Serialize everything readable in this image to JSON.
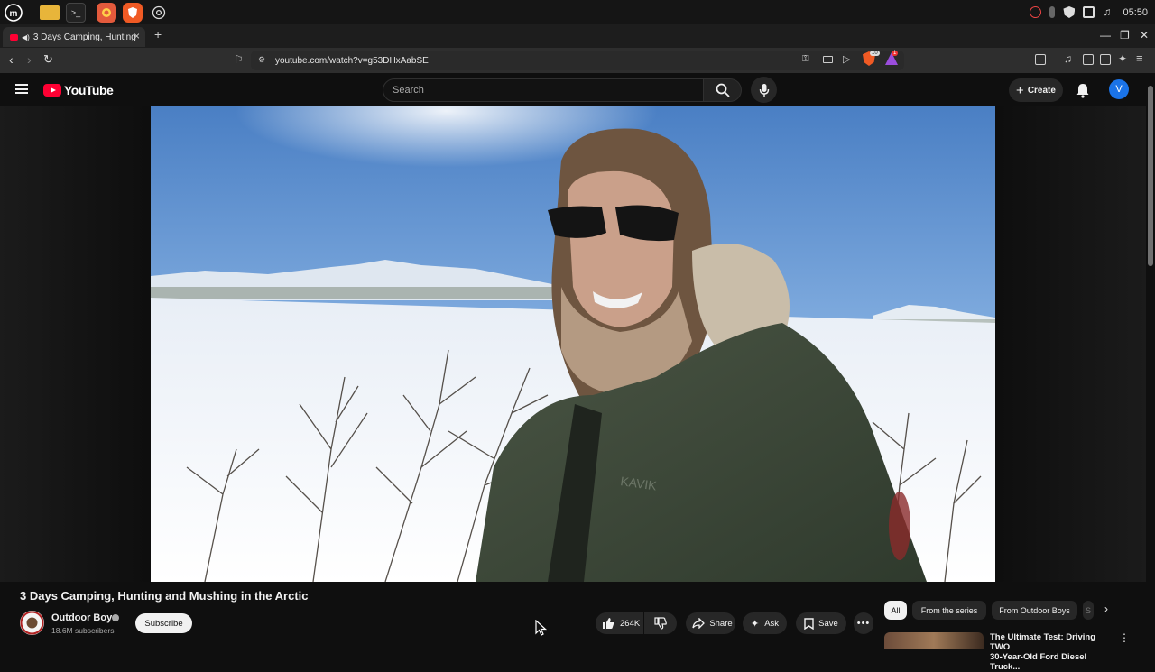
{
  "taskbar": {
    "apps": [
      "mint-menu",
      "files",
      "terminal",
      "firefox",
      "brave",
      "chrome"
    ],
    "clock": "05:50"
  },
  "browser": {
    "tab_title": "3 Days Camping, Hunting",
    "url": "youtube.com/watch?v=g53DHxAabSE",
    "shield_badge": "10",
    "alert_badge": "1"
  },
  "header": {
    "logo_text": "YouTube",
    "search_placeholder": "Search",
    "create_label": "Create",
    "avatar_letter": "V"
  },
  "video": {
    "title": "3 Days Camping, Hunting and Mushing in the Arctic",
    "jacket_text": "KAVIK"
  },
  "channel": {
    "name": "Outdoor Boys",
    "subscribers": "18.6M subscribers",
    "subscribe_label": "Subscribe"
  },
  "actions": {
    "likes": "264K",
    "share_label": "Share",
    "ask_label": "Ask",
    "save_label": "Save"
  },
  "chips": {
    "all": "All",
    "series": "From the series",
    "channel": "From Outdoor Boys",
    "cut": "S"
  },
  "recommendation": {
    "title_line1": "The Ultimate Test: Driving TWO",
    "title_line2": "30-Year-Old Ford Diesel Truck..."
  },
  "colors": {
    "yt_red": "#ff0033",
    "background": "#0f0f0f",
    "pill": "#272727",
    "avatar_blue": "#1a73e8"
  }
}
